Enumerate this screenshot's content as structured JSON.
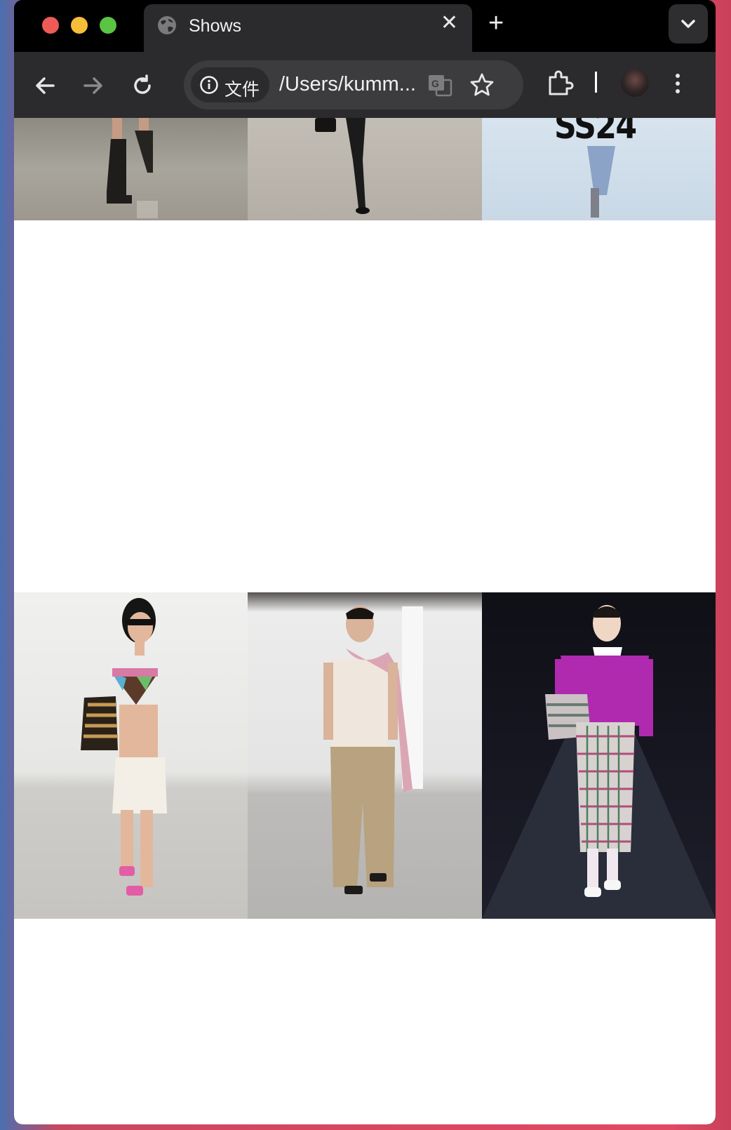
{
  "browser": {
    "tab_title": "Shows",
    "tab_close_glyph": "✕",
    "new_tab_glyph": "+",
    "site_info_label": "文件",
    "url": "/Users/kumm...",
    "icons": [
      "globe-icon",
      "close-icon",
      "plus-icon",
      "chevron-down-icon",
      "back-icon",
      "forward-icon",
      "reload-icon",
      "info-icon",
      "translate-icon",
      "star-icon",
      "extensions-icon",
      "more-icon"
    ]
  },
  "gallery": {
    "top_row": [
      {
        "name": "Runway look with black boots",
        "overlay_text": ""
      },
      {
        "name": "Runway look with black tights and heels",
        "overlay_text": ""
      },
      {
        "name": "Runway look with season title",
        "overlay_text": "SS24"
      }
    ],
    "bottom_row": [
      {
        "name": "Crochet bandeau and white knit skirt look",
        "overlay_text": ""
      },
      {
        "name": "Tank top with wide beige trousers look",
        "overlay_text": ""
      },
      {
        "name": "Magenta sweater and plaid skirt look",
        "overlay_text": ""
      }
    ]
  },
  "colors": {
    "traffic_red": "#ee5b56",
    "traffic_yellow": "#f6bd3a",
    "traffic_green": "#5ac443",
    "chrome_dark": "#2b2b2d",
    "page_bg": "#ffffff"
  }
}
